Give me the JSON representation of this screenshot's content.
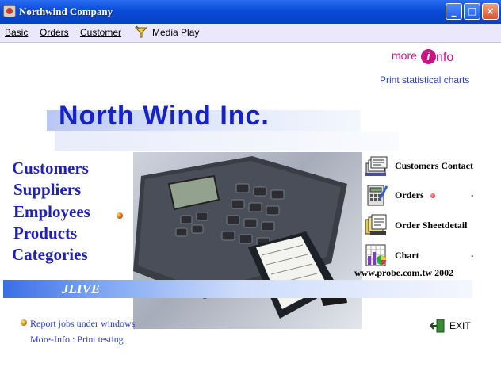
{
  "window": {
    "title": "Northwind Company",
    "buttons": {
      "minimize": "_",
      "maximize": "□",
      "close": "×"
    }
  },
  "menubar": {
    "items": [
      "Basic",
      "Orders",
      "Customer",
      "Media Play"
    ]
  },
  "more_info_logo": {
    "more": "more",
    "i": "i",
    "nfo": "nfo"
  },
  "print_link": "Print statistical charts",
  "banner_title": "North Wind Inc.",
  "left_menu": [
    "Customers",
    "Suppliers",
    "Employees",
    "Products",
    "Categories"
  ],
  "right_menu": [
    {
      "label": "Customers Contact",
      "icon": "contact-cards-icon"
    },
    {
      "label": "Orders",
      "icon": "order-calculator-icon",
      "period": "."
    },
    {
      "label": "Order Sheetdetail",
      "icon": "order-sheets-icon"
    },
    {
      "label": "Chart",
      "icon": "chart-icon",
      "period": "."
    }
  ],
  "website": "www.probe.com.tw  2002",
  "jlive": "JLIVE",
  "footer": {
    "report_link": "Report jobs under windows",
    "moreinfo_link": "More-Info : Print testing",
    "exit": "EXIT"
  },
  "colors": {
    "titlebar": "#0a4ad8",
    "menubar": "#ebe8fb",
    "link": "#2b3bd1",
    "menu_text": "#1f20b8",
    "banner_text": "#1622c6",
    "logo": "#c7158f"
  }
}
